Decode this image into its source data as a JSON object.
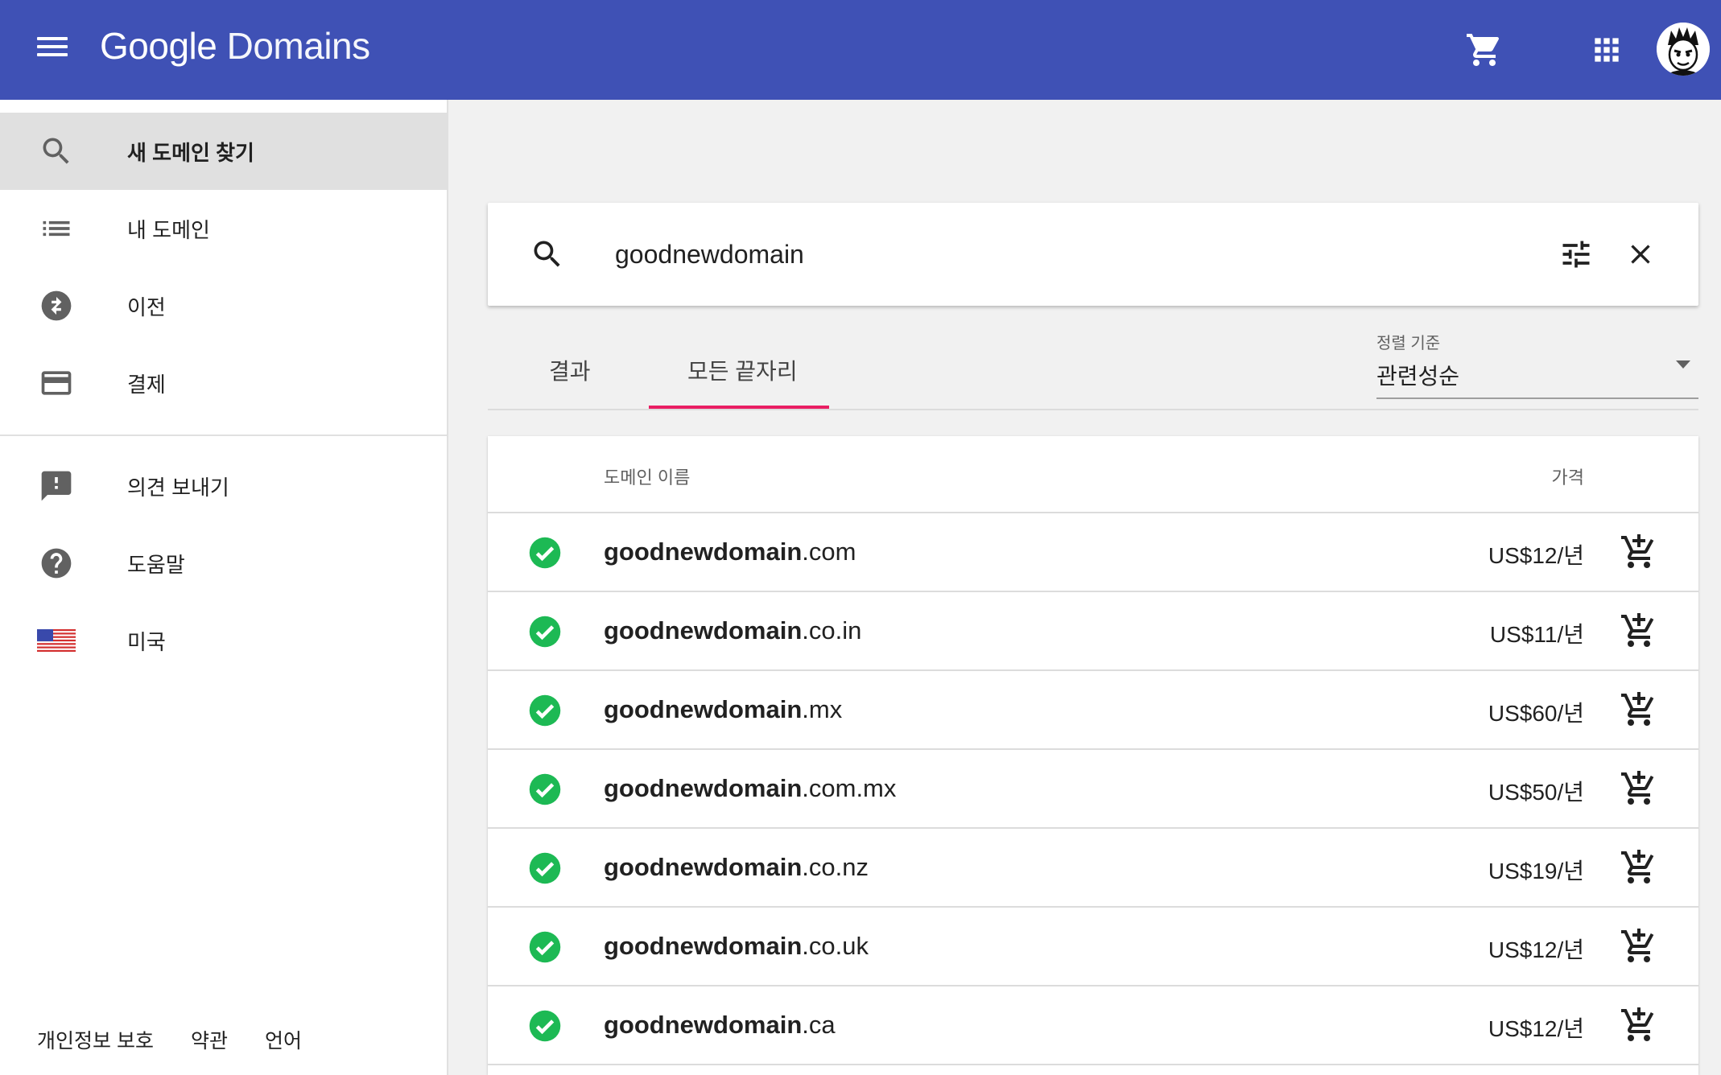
{
  "header": {
    "brand_google": "Google",
    "brand_product": "Domains",
    "color": "#3f51b5",
    "icons": [
      "menu-icon",
      "cart-icon",
      "apps-grid-icon",
      "avatar"
    ]
  },
  "sidebar": {
    "items": [
      {
        "label": "새 도메인 찾기",
        "icon": "search-icon",
        "active": true
      },
      {
        "label": "내 도메인",
        "icon": "list-icon"
      },
      {
        "label": "이전",
        "icon": "transfer-icon"
      },
      {
        "label": "결제",
        "icon": "credit-card-icon"
      },
      {
        "label": "의견 보내기",
        "icon": "feedback-icon"
      },
      {
        "label": "도움말",
        "icon": "help-icon"
      },
      {
        "label": "미국",
        "icon": "us-flag-icon"
      }
    ],
    "footer": {
      "privacy": "개인정보 보호",
      "terms": "약관",
      "language": "언어"
    }
  },
  "search": {
    "query": "goodnewdomain"
  },
  "tabs": {
    "results": "결과",
    "all_endings": "모든 끝자리",
    "active": "all_endings",
    "accent_color": "#e91e63"
  },
  "sort": {
    "label": "정렬 기준",
    "value": "관련성순"
  },
  "table": {
    "headers": {
      "name": "도메인 이름",
      "price": "가격"
    },
    "rows": [
      {
        "name": "goodnewdomain",
        "tld": ".com",
        "price": "US$12/년",
        "available": true
      },
      {
        "name": "goodnewdomain",
        "tld": ".co.in",
        "price": "US$11/년",
        "available": true
      },
      {
        "name": "goodnewdomain",
        "tld": ".mx",
        "price": "US$60/년",
        "available": true
      },
      {
        "name": "goodnewdomain",
        "tld": ".com.mx",
        "price": "US$50/년",
        "available": true
      },
      {
        "name": "goodnewdomain",
        "tld": ".co.nz",
        "price": "US$19/년",
        "available": true
      },
      {
        "name": "goodnewdomain",
        "tld": ".co.uk",
        "price": "US$12/년",
        "available": true
      },
      {
        "name": "goodnewdomain",
        "tld": ".ca",
        "price": "US$12/년",
        "available": true
      }
    ],
    "available_color": "#1db954"
  }
}
